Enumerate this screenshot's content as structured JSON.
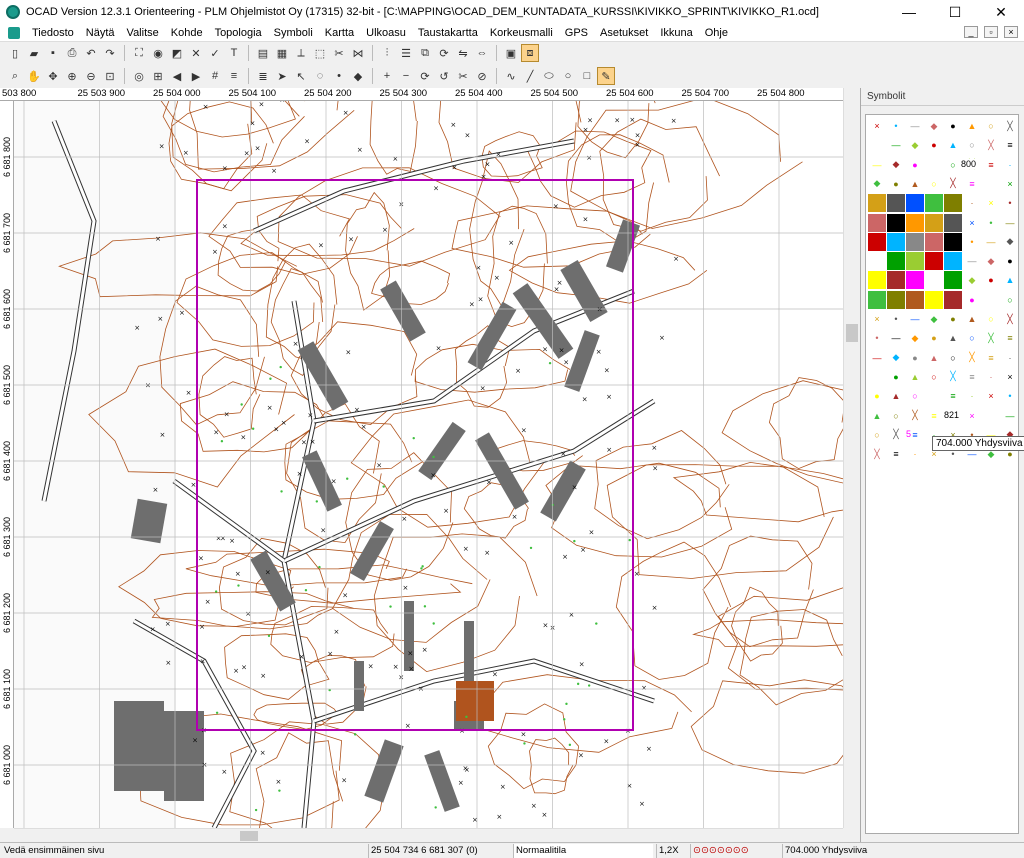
{
  "title": "OCAD Version 12.3.1  Orienteering - PLM Ohjelmistot Oy (17315) 32-bit - [C:\\MAPPING\\OCAD_DEM_KUNTADATA_KURSSI\\KIVIKKO_SPRINT\\KIVIKKO_R1.ocd]",
  "window_buttons": {
    "minimize": "—",
    "maximize": "☐",
    "close": "✕"
  },
  "menu": [
    "Tiedosto",
    "Näytä",
    "Valitse",
    "Kohde",
    "Topologia",
    "Symboli",
    "Kartta",
    "Ulkoasu",
    "Taustakartta",
    "Korkeusmalli",
    "GPS",
    "Asetukset",
    "Ikkuna",
    "Ohje"
  ],
  "mdi_buttons": [
    "_",
    "▫",
    "×"
  ],
  "toolbar1": [
    "new-icon",
    "open-icon",
    "save-icon",
    "print-icon",
    "undo-icon",
    "redo-icon",
    "zoom-frame-icon",
    "eye-icon",
    "color-icon",
    "delete-icon",
    "check-icon",
    "text-icon",
    "layout-icon",
    "grid-icon",
    "measure-icon",
    "select-icon",
    "cut-icon",
    "join-icon",
    "split-icon",
    "align-icon",
    "duplicate-icon",
    "rotate-icon",
    "mirror-icon",
    "stretch-icon",
    "fill-icon",
    "arrange-icon"
  ],
  "toolbar2": [
    "binoculars-icon",
    "hand-icon",
    "pan-icon",
    "zoom-in-icon",
    "zoom-out-icon",
    "zoom-window-icon",
    "zoom-100-icon",
    "zoom-all-icon",
    "back-icon",
    "forward-icon",
    "grid-snap-icon",
    "list-icon",
    "list2-icon",
    "pointer-icon",
    "edit-icon",
    "lasso-icon",
    "point-icon",
    "vertex-icon",
    "insert-icon",
    "delete-vertex-icon",
    "rotate-icon",
    "reshape-icon",
    "scissors-icon",
    "cut-hole-icon",
    "curve-icon",
    "line-icon",
    "ellipse-icon",
    "circle-icon",
    "rectangle-icon",
    "freehand-icon"
  ],
  "ruler_h": [
    "503 800",
    "25 503 900",
    "25 504 000",
    "25 504 100",
    "25 504 200",
    "25 504 300",
    "25 504 400",
    "25 504 500",
    "25 504 600",
    "25 504 700",
    "25 504 800"
  ],
  "ruler_v": [
    "6 681 800",
    "6 681 700",
    "6 681 600",
    "6 681 500",
    "6 681 400",
    "6 681 300",
    "6 681 200",
    "6 681 100",
    "6 681 000"
  ],
  "symbol_panel_title": "Symbolit",
  "symbol_800": "800",
  "symbol_821": "821",
  "symbol_5": "5",
  "tooltip": "704.000 Yhdysviiva",
  "status": {
    "hint": "Vedä ensimmäinen sivu",
    "coords": "25 504 734   6 681 307   (0)",
    "mode": "Normaalitila",
    "zoom": "1,2X",
    "symbol": "704.000 Yhdysviiva"
  },
  "colors": {
    "print_frame": "#b000b0",
    "contour": "#b0541e",
    "building": "#6e6e6e",
    "grid": "#bdbdbd",
    "accent": "#1a9b8c"
  }
}
